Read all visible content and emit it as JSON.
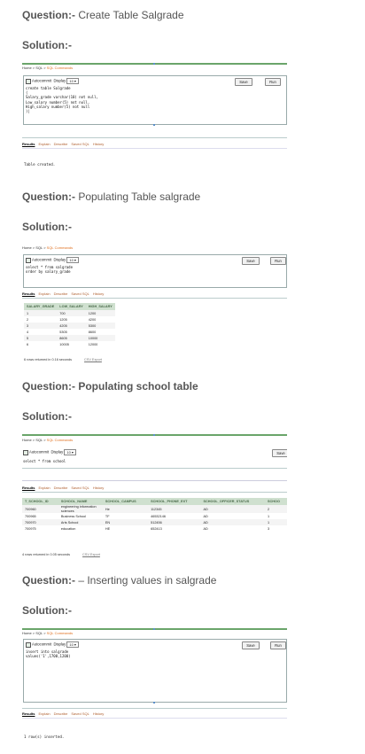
{
  "q1": {
    "label": "Question:-",
    "text": " Create Table Salgrade"
  },
  "s1": {
    "label": "Solution:-"
  },
  "q2": {
    "label": "Question:-",
    "text": " Populating Table salgrade"
  },
  "s2": {
    "label": "Solution:-"
  },
  "q3": {
    "label": "Question:-",
    "text": " Populating school table"
  },
  "s3": {
    "label": "Solution:-"
  },
  "q4": {
    "label": "Question:-",
    "text": " – Inserting values in salgrade"
  },
  "s4": {
    "label": "Solution:-"
  },
  "ui": {
    "crumb_home": "Home",
    "crumb_sql": "SQL",
    "crumb_current": "SQL Commands",
    "sep": " > ",
    "autocommit": "Autocommit",
    "display": "Display",
    "display_value": "10",
    "save": "Save",
    "run": "Run",
    "tab_results": "Results",
    "tab_explain": "Explain",
    "tab_describe": "Describe",
    "tab_saved": "Saved SQL",
    "tab_history": "History",
    "csv": "CSV Export"
  },
  "shot1": {
    "code": "create table Salgrade\n(\nSalary_grade varchar(10) not null,\nLow_salary number(5) not null,\nHigh_salary number(5) not null\n)|",
    "message": "Table created."
  },
  "shot2": {
    "code": "select * from salgrade\norder by salary_grade",
    "headers": [
      "SALARY_GRADE",
      "LOW_SALARY",
      "HIGH_SALARY"
    ],
    "rows": [
      [
        "1",
        "700",
        "1200"
      ],
      [
        "2",
        "1205",
        "4200"
      ],
      [
        "3",
        "4205",
        "5300"
      ],
      [
        "4",
        "5305",
        "8600"
      ],
      [
        "5",
        "8605",
        "10000"
      ],
      [
        "6",
        "10005",
        "12000"
      ]
    ],
    "footer": "6 rows returned in 0.16 seconds"
  },
  "shot3": {
    "code": "select * from school",
    "headers": [
      "T_SCHOOL_ID",
      "SCHOOL_NAME",
      "SCHOOL_CAMPUS",
      "SCHOOL_PHONE_EXT",
      "SCHOOL_OFFICER_STATUS",
      "SCHOO"
    ],
    "rows": [
      [
        "700960",
        "engineering information sciences",
        "He",
        "112345",
        "AD",
        "2"
      ],
      [
        "700965",
        "Business School",
        "TF",
        "46532146",
        "AD",
        "1"
      ],
      [
        "700970",
        "Arts School",
        "EN",
        "512456",
        "AD",
        "1"
      ],
      [
        "700975",
        "education",
        "HE",
        "652413",
        "AD",
        "3"
      ]
    ],
    "footer": "4 rows returned in 0.05 seconds"
  },
  "shot4": {
    "code": "insert into salgrade\nvalues('1',1700,1200)",
    "message": "1 row(s) inserted."
  }
}
